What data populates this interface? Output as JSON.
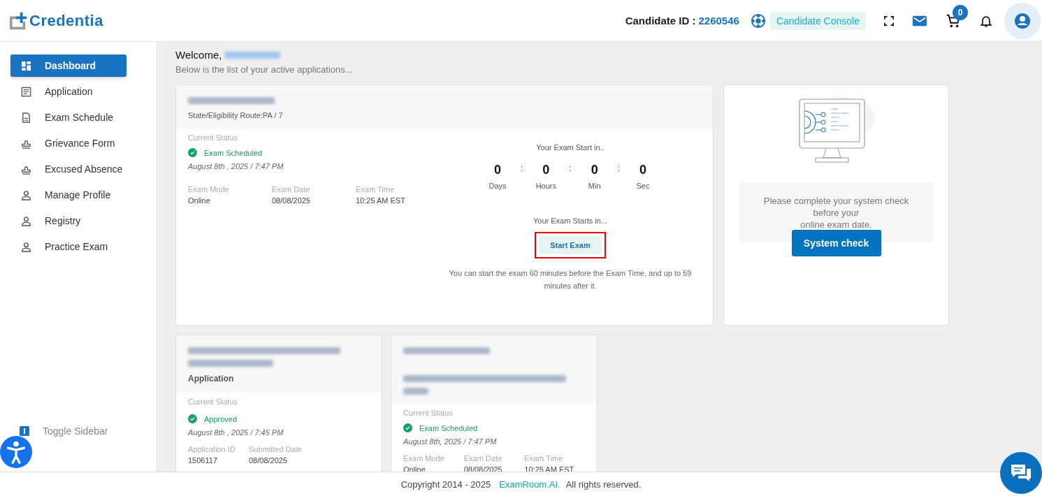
{
  "header": {
    "logo": "Credentia",
    "candidate_id_label": "Candidate ID :",
    "candidate_id": "2260546",
    "console_button": "Candidate Console",
    "cart_count": "0"
  },
  "sidebar": {
    "items": [
      {
        "label": "Dashboard",
        "kind": "grid",
        "selected": true
      },
      {
        "label": "Application",
        "kind": "list",
        "selected": false
      },
      {
        "label": "Exam Schedule",
        "kind": "document",
        "selected": false
      },
      {
        "label": "Grievance Form",
        "kind": "stamp",
        "selected": false
      },
      {
        "label": "Excused Absence",
        "kind": "stamp",
        "selected": false
      },
      {
        "label": "Manage Profile",
        "kind": "person",
        "selected": false
      },
      {
        "label": "Registry",
        "kind": "person",
        "selected": false
      },
      {
        "label": "Practice Exam",
        "kind": "person",
        "selected": false
      }
    ],
    "toggle": "Toggle Sidebar"
  },
  "welcome": {
    "greeting": "Welcome,",
    "subtitle": "Below is the list of your active applications..."
  },
  "exam_card": {
    "route": "State/Eligibility Route:PA / 7",
    "status_label": "Current Status",
    "status": "Exam Scheduled",
    "timestamp": "August 8th , 2025 / 7:47 PM",
    "fields": [
      {
        "label": "Exam Mode",
        "value": "Online"
      },
      {
        "label": "Exam Date",
        "value": "08/08/2025"
      },
      {
        "label": "Exam Time",
        "value": "10:25 AM EST"
      }
    ],
    "countdown_title": "Your Exam Start in..",
    "countdown": [
      {
        "value": "0",
        "unit": "Days"
      },
      {
        "value": "0",
        "unit": "Hours"
      },
      {
        "value": "0",
        "unit": "Min"
      },
      {
        "value": "0",
        "unit": "Sec"
      }
    ],
    "countdown_separator": ":",
    "starts_text": "Your Exam Starts in...",
    "start_button": "Start Exam",
    "note": "You can start the exam 60 minutes before the Exam Time, and up to 59 minutes after it."
  },
  "system_check": {
    "message": "Please complete your system check\nbefore your\nonline exam date.",
    "button": "System check"
  },
  "cards": [
    {
      "kind": "application",
      "subtitle": "Application",
      "status_label": "Current Status",
      "status": "Approved",
      "timestamp": "August 8th , 2025 / 7:45 PM",
      "fields": [
        {
          "label": "Application ID",
          "value": "1506117"
        },
        {
          "label": "Submitted Date",
          "value": "08/08/2025"
        }
      ]
    },
    {
      "kind": "exam",
      "status_label": "Current Status",
      "status": "Exam Scheduled",
      "timestamp": "August 8th, 2025 / 7:47 PM",
      "fields": [
        {
          "label": "Exam Mode",
          "value": "Online"
        },
        {
          "label": "Exam Date",
          "value": "08/08/2025"
        },
        {
          "label": "Exam Time",
          "value": "10:25 AM EST"
        }
      ]
    }
  ],
  "footer": {
    "copyright": "Copyright 2014 - 2025",
    "link": "ExamRoom.AI.",
    "rights": "All rights reserved."
  }
}
